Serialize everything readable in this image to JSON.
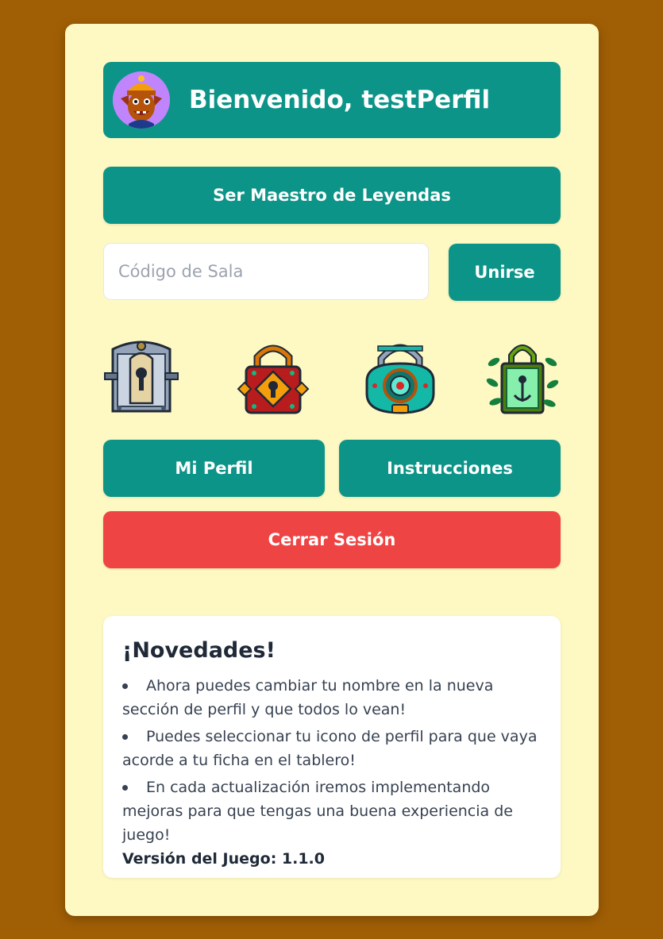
{
  "header": {
    "title": "Bienvenido, testPerfil",
    "avatar_icon": "goblin-avatar-icon"
  },
  "master_button": {
    "label": "Ser Maestro de Leyendas"
  },
  "join": {
    "placeholder": "Código de Sala",
    "value": "",
    "button_label": "Unirse"
  },
  "locks": [
    {
      "icon": "steel-keyhole-lock-icon"
    },
    {
      "icon": "ornate-red-padlock-icon"
    },
    {
      "icon": "teal-mosaic-padlock-icon"
    },
    {
      "icon": "vine-green-padlock-icon"
    }
  ],
  "nav": {
    "profile_label": "Mi Perfil",
    "instructions_label": "Instrucciones",
    "logout_label": "Cerrar Sesión"
  },
  "news": {
    "title": "¡Novedades!",
    "items": [
      "Ahora puedes cambiar tu nombre en la nueva sección de perfil y que todos lo vean!",
      "Puedes seleccionar tu icono de perfil para que vaya acorde a tu ficha en el tablero!",
      "En cada actualización iremos implementando mejoras para que tengas una buena experiencia de juego!"
    ],
    "version": "Versión del Juego: 1.1.0"
  },
  "colors": {
    "background": "#a15f05",
    "card": "#fef9c3",
    "primary": "#0d9488",
    "danger": "#ef4444"
  }
}
